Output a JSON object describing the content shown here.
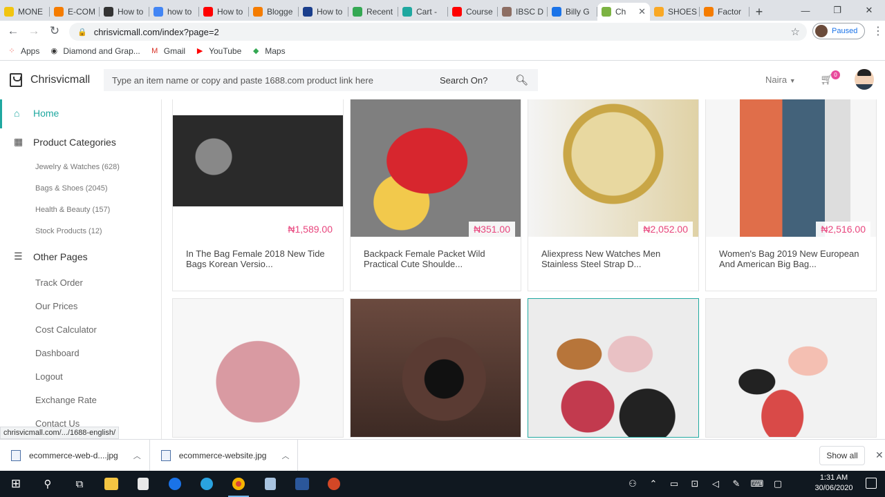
{
  "browser": {
    "tabs": [
      {
        "label": "MONE",
        "color": "#f1c40f"
      },
      {
        "label": "E-COM",
        "color": "#f57c00"
      },
      {
        "label": "How to",
        "color": "#333333"
      },
      {
        "label": "how to",
        "color": "#4285f4"
      },
      {
        "label": "How to",
        "color": "#ff0000"
      },
      {
        "label": "Blogge",
        "color": "#f57c00"
      },
      {
        "label": "How to",
        "color": "#1a3e8c"
      },
      {
        "label": "Recent",
        "color": "#34a853"
      },
      {
        "label": "Cart -",
        "color": "#1fa8a0"
      },
      {
        "label": "Course",
        "color": "#ff0000"
      },
      {
        "label": "IBSC D",
        "color": "#8d6e63"
      },
      {
        "label": "Billy G",
        "color": "#1a73e8"
      },
      {
        "label": "Ch",
        "color": "#7cb342",
        "active": true
      },
      {
        "label": "SHOES",
        "color": "#f9a825"
      },
      {
        "label": "Factor",
        "color": "#f57c00"
      }
    ],
    "url": "chrisvicmall.com/index?page=2",
    "profile_status": "Paused",
    "bookmarks": [
      {
        "label": "Apps",
        "icon": "apps-grid-icon"
      },
      {
        "label": "Diamond and Grap...",
        "icon": "globe-icon"
      },
      {
        "label": "Gmail",
        "icon": "gmail-icon"
      },
      {
        "label": "YouTube",
        "icon": "youtube-icon"
      },
      {
        "label": "Maps",
        "icon": "maps-icon"
      }
    ],
    "status_url": "chrisvicmall.com/.../1688-english/"
  },
  "site": {
    "brand": "Chrisvicmall",
    "search_placeholder": "Type an item name  or copy and paste 1688.com product link here",
    "search_on": "Search On?",
    "currency": "Naira",
    "cart_count": "0"
  },
  "sidebar": {
    "home": "Home",
    "categories_heading": "Product Categories",
    "categories": [
      "Jewelry & Watches (628)",
      "Bags & Shoes (2045)",
      "Health & Beauty (157)",
      "Stock Products (12)"
    ],
    "other_heading": "Other Pages",
    "pages": [
      "Track Order",
      "Our Prices",
      "Cost Calculator",
      "Dashboard",
      "Logout",
      "Exchange Rate",
      "Contact Us"
    ]
  },
  "products": [
    {
      "price": "₦1,589.00",
      "title": "In The Bag Female 2018 New Tide Bags Korean Versio..."
    },
    {
      "price": "₦351.00",
      "title": "Backpack Female Packet Wild Practical Cute Shoulde..."
    },
    {
      "price": "₦2,052.00",
      "title": "Aliexpress New Watches Men Stainless Steel Strap D..."
    },
    {
      "price": "₦2,516.00",
      "title": "Women's Bag 2019 New European And American Big Bag..."
    },
    {
      "price": "",
      "title": ""
    },
    {
      "price": "",
      "title": ""
    },
    {
      "price": "",
      "title": ""
    },
    {
      "price": "",
      "title": ""
    }
  ],
  "downloads": {
    "files": [
      "ecommerce-web-d....jpg",
      "ecommerce-website.jpg"
    ],
    "show_all": "Show all"
  },
  "taskbar": {
    "time": "1:31 AM",
    "date": "30/06/2020"
  },
  "colors": {
    "accent": "#1fa8a0",
    "price": "#e8457d",
    "badge": "#e84a9c"
  }
}
